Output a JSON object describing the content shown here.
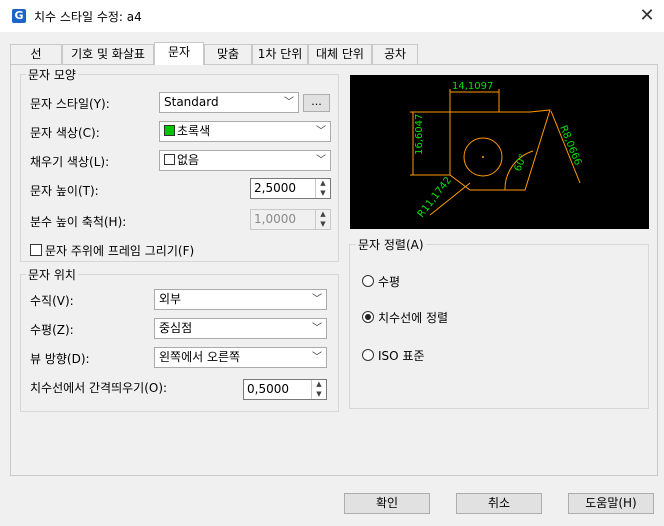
{
  "window": {
    "title": "치수 스타일 수정: a4",
    "app_icon": "G",
    "close": "✕"
  },
  "tabs": [
    {
      "label": "선"
    },
    {
      "label": "기호 및 화살표"
    },
    {
      "label": "문자"
    },
    {
      "label": "맞춤"
    },
    {
      "label": "1차 단위"
    },
    {
      "label": "대체 단위"
    },
    {
      "label": "공차"
    }
  ],
  "active_tab": "문자",
  "text_appearance": {
    "title": "문자 모양",
    "style": {
      "label": "문자 스타일(Y):",
      "value": "Standard",
      "browse": "..."
    },
    "color": {
      "label": "문자 색상(C):",
      "value": "초록색",
      "swatch": "#00c800"
    },
    "fill": {
      "label": "채우기 색상(L):",
      "value": "없음",
      "swatch": "#ffffff"
    },
    "height": {
      "label": "문자 높이(T):",
      "value": "2,5000"
    },
    "fraction": {
      "label": "분수 높이 축척(H):",
      "value": "1,0000"
    },
    "frame": {
      "label": "문자 주위에 프레임 그리기(F)",
      "checked": false
    }
  },
  "text_placement": {
    "title": "문자 위치",
    "vertical": {
      "label": "수직(V):",
      "value": "외부"
    },
    "horizontal": {
      "label": "수평(Z):",
      "value": "중심점"
    },
    "view_direction": {
      "label": "뷰 방향(D):",
      "value": "왼쪽에서 오른쪽"
    },
    "offset": {
      "label": "치수선에서 간격띄우기(O):",
      "value": "0,5000"
    }
  },
  "preview": {
    "dims": [
      "14,1097",
      "16,6047",
      "R11,1742",
      "60°",
      "R8,0666"
    ],
    "line_color": "#ff9900",
    "text_color": "#00e000"
  },
  "text_alignment": {
    "title": "문자 정렬(A)",
    "options": [
      {
        "label": "수평",
        "checked": false
      },
      {
        "label": "치수선에 정렬",
        "checked": true
      },
      {
        "label": "ISO 표준",
        "checked": false
      }
    ]
  },
  "footer": {
    "ok": "확인",
    "cancel": "취소",
    "help": "도움말(H)"
  }
}
